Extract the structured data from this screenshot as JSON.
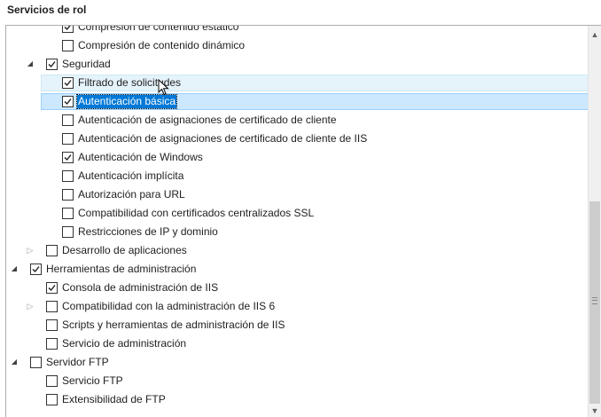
{
  "title": "Servicios de rol",
  "colors": {
    "selection_fill": "#cce8ff",
    "selection_border": "#99d1ff",
    "hover_fill": "#e5f3fb",
    "focus_text_bg": "#0078d7"
  },
  "tree": [
    {
      "label": "Compresión de contenido estático",
      "level": 3,
      "checked": true,
      "expander": "none",
      "state": ""
    },
    {
      "label": "Compresión de contenido dinámico",
      "level": 3,
      "checked": false,
      "expander": "none",
      "state": ""
    },
    {
      "label": "Seguridad",
      "level": 2,
      "checked": true,
      "expander": "expanded",
      "state": ""
    },
    {
      "label": "Filtrado de solicitudes",
      "level": 3,
      "checked": true,
      "expander": "none",
      "state": "hover"
    },
    {
      "label": "Autenticación básica",
      "level": 3,
      "checked": true,
      "expander": "none",
      "state": "selected"
    },
    {
      "label": "Autenticación de asignaciones de certificado de cliente",
      "level": 3,
      "checked": false,
      "expander": "none",
      "state": ""
    },
    {
      "label": "Autenticación de asignaciones de certificado de cliente de IIS",
      "level": 3,
      "checked": false,
      "expander": "none",
      "state": ""
    },
    {
      "label": "Autenticación de Windows",
      "level": 3,
      "checked": true,
      "expander": "none",
      "state": ""
    },
    {
      "label": "Autenticación implícita",
      "level": 3,
      "checked": false,
      "expander": "none",
      "state": ""
    },
    {
      "label": "Autorización para URL",
      "level": 3,
      "checked": false,
      "expander": "none",
      "state": ""
    },
    {
      "label": "Compatibilidad con certificados centralizados SSL",
      "level": 3,
      "checked": false,
      "expander": "none",
      "state": ""
    },
    {
      "label": "Restricciones de IP y dominio",
      "level": 3,
      "checked": false,
      "expander": "none",
      "state": ""
    },
    {
      "label": "Desarrollo de aplicaciones",
      "level": 2,
      "checked": false,
      "expander": "collapsed",
      "state": ""
    },
    {
      "label": "Herramientas de administración",
      "level": 1,
      "checked": true,
      "expander": "expanded",
      "state": ""
    },
    {
      "label": "Consola de administración de IIS",
      "level": 2,
      "checked": true,
      "expander": "none",
      "state": ""
    },
    {
      "label": "Compatibilidad con la administración de IIS 6",
      "level": 2,
      "checked": false,
      "expander": "collapsed",
      "state": ""
    },
    {
      "label": "Scripts y herramientas de administración de IIS",
      "level": 2,
      "checked": false,
      "expander": "none",
      "state": ""
    },
    {
      "label": "Servicio de administración",
      "level": 2,
      "checked": false,
      "expander": "none",
      "state": ""
    },
    {
      "label": "Servidor FTP",
      "level": 1,
      "checked": false,
      "expander": "expanded",
      "state": ""
    },
    {
      "label": "Servicio FTP",
      "level": 2,
      "checked": false,
      "expander": "none",
      "state": ""
    },
    {
      "label": "Extensibilidad de FTP",
      "level": 2,
      "checked": false,
      "expander": "none",
      "state": ""
    }
  ],
  "scrollbar": {
    "up_icon": "chevron-up-icon",
    "down_icon": "chevron-down-icon"
  }
}
